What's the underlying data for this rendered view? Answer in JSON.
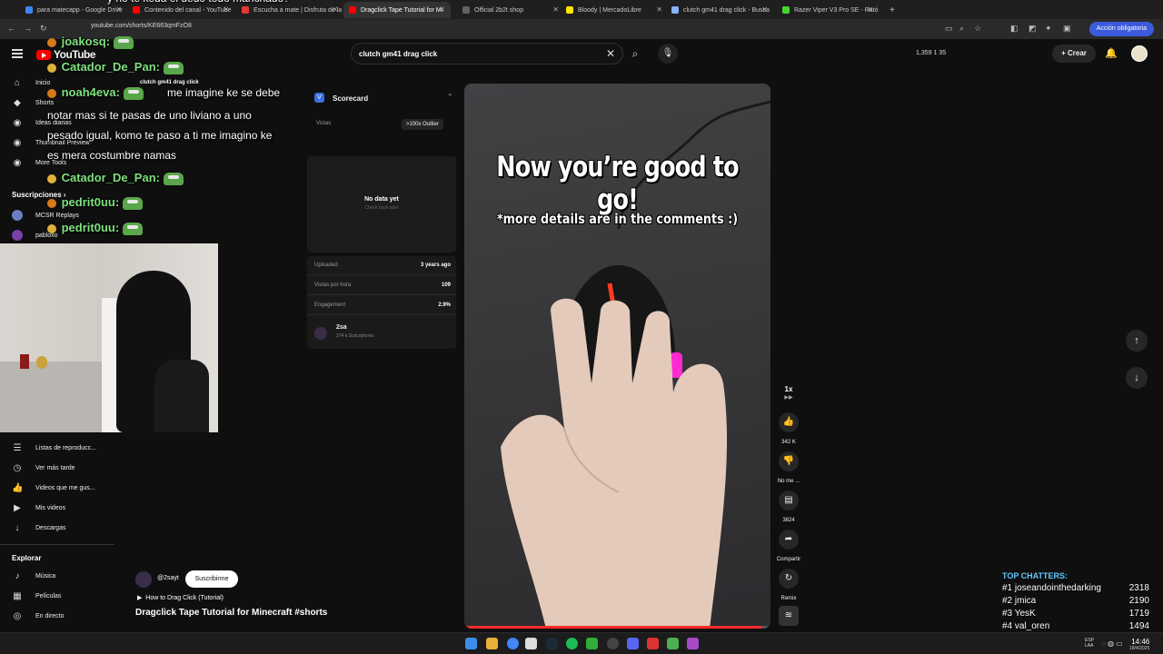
{
  "browser": {
    "tabs": [
      {
        "label": "para matecapp - Google Drive",
        "color": "#4285f4"
      },
      {
        "label": "Contenido del canal - YouTube",
        "color": "#ff0000"
      },
      {
        "label": "Escucha a mate | Disfruta de la",
        "color": "#e53935"
      },
      {
        "label": "Dragclick Tape Tutorial for Mi",
        "color": "#ff0000"
      },
      {
        "label": "Official 2b2t shop",
        "color": "#5f6368"
      },
      {
        "label": "Bloody | MercadoLibre",
        "color": "#ffe600"
      },
      {
        "label": "clutch gm41 drag click - Busca",
        "color": "#8ab4f8"
      },
      {
        "label": "Razer Viper V3 Pro SE - Ratón",
        "color": "#44d62c"
      }
    ],
    "url": "youtube.com/shorts/KE663qmFzO8",
    "action_button": "Acción obligatoria"
  },
  "header": {
    "logo": "YouTube",
    "search_query": "clutch gm41 drag click",
    "stats": "1,359   1   35",
    "create": "Crear"
  },
  "sidebar": {
    "items": [
      {
        "label": "Inicio",
        "icon": "home-icon",
        "glyph": "⌂"
      },
      {
        "label": "Shorts",
        "icon": "shorts-icon",
        "glyph": "◆"
      },
      {
        "label": "Ideas diarias",
        "icon": "ideas-icon",
        "glyph": "◉"
      },
      {
        "label": "Thumbnail Preview",
        "icon": "thumbnail-icon",
        "glyph": "◉"
      },
      {
        "label": "More Tools",
        "icon": "tools-icon",
        "glyph": "◉"
      }
    ],
    "subs_heading": "Suscripciones",
    "subs": [
      {
        "label": "MCSR Replays",
        "color": "#6b7fbf"
      },
      {
        "label": "pabloxo",
        "color": "#7b3fa8"
      }
    ],
    "you_items": [
      {
        "label": "Listas de reproducc...",
        "icon": "playlist-icon",
        "glyph": "☰"
      },
      {
        "label": "Ver más tarde",
        "icon": "clock-icon",
        "glyph": "◷"
      },
      {
        "label": "Videos que me gus...",
        "icon": "like-icon",
        "glyph": "👍"
      },
      {
        "label": "Mis videos",
        "icon": "video-icon",
        "glyph": "▶"
      },
      {
        "label": "Descargas",
        "icon": "download-icon",
        "glyph": "↓"
      }
    ],
    "explore_heading": "Explorar",
    "explore_items": [
      {
        "label": "Música",
        "icon": "music-icon",
        "glyph": "♪"
      },
      {
        "label": "Películas",
        "icon": "film-icon",
        "glyph": "▦"
      },
      {
        "label": "En directo",
        "icon": "live-icon",
        "glyph": "◎"
      }
    ]
  },
  "scorecard": {
    "title": "Scorecard",
    "views_label": "Vistas",
    "outlier": ">100x Outlier",
    "views_value": "12 M",
    "no_data": "No data yet",
    "check_back": "Check back later",
    "uploaded_label": "Uploaded",
    "uploaded_value": "3 years ago",
    "vph_label": "Vistas por hora",
    "vph_value": "109",
    "engagement_label": "Engagement",
    "engagement_value": "2.9%",
    "channel": "2sa",
    "channel_subs": "374 k Suscriptores"
  },
  "video": {
    "headline": "Now you’re good to go!",
    "subline": "*more details are in the comments :)",
    "progress": 0.97,
    "hover_title": "clutch gm41 drag click"
  },
  "actions": {
    "speed": "1x",
    "likes": "342 K",
    "dislike": "No me ...",
    "comments": "3824",
    "share": "Compartir",
    "remix": "Remix"
  },
  "channel": {
    "handle": "@2sayt",
    "subscribe": "Suscribirme",
    "howto": "How to Drag Click (Tutorial)",
    "title": "Dragclick Tape Tutorial for Minecraft #shorts"
  },
  "chat": {
    "top_partial": "y no te keda el dedo todo manchado?",
    "lines": [
      {
        "type": "user",
        "text": "joakosq:"
      },
      {
        "type": "user",
        "text": "Catador_De_Pan:"
      },
      {
        "type": "user",
        "text": "noah4eva:"
      },
      {
        "type": "msg",
        "text": "me imagine ke se debe"
      },
      {
        "type": "msg",
        "text": "notar mas si te pasas de uno liviano a uno"
      },
      {
        "type": "msg",
        "text": "pesado igual, komo te paso a ti me imagino ke"
      },
      {
        "type": "msg",
        "text": "es mera costumbre namas"
      },
      {
        "type": "user",
        "text": "Catador_De_Pan:"
      },
      {
        "type": "user",
        "text": "pedrit0uu:"
      },
      {
        "type": "user",
        "text": "pedrit0uu:"
      }
    ]
  },
  "top_chatters": {
    "heading": "TOP CHATTERS:",
    "rows": [
      {
        "rank": "#1",
        "name": "joseandointhedarking",
        "count": "2318"
      },
      {
        "rank": "#2",
        "name": "jmica",
        "count": "2190"
      },
      {
        "rank": "#3",
        "name": "YesK",
        "count": "1719"
      },
      {
        "rank": "#4",
        "name": "val_oren",
        "count": "1494"
      },
      {
        "rank": "#5",
        "name": "ibuprofeno",
        "count": "1462"
      }
    ]
  },
  "taskbar": {
    "lang": "ESP\nLAA",
    "time": "14:46",
    "date": "18/4/2025"
  }
}
